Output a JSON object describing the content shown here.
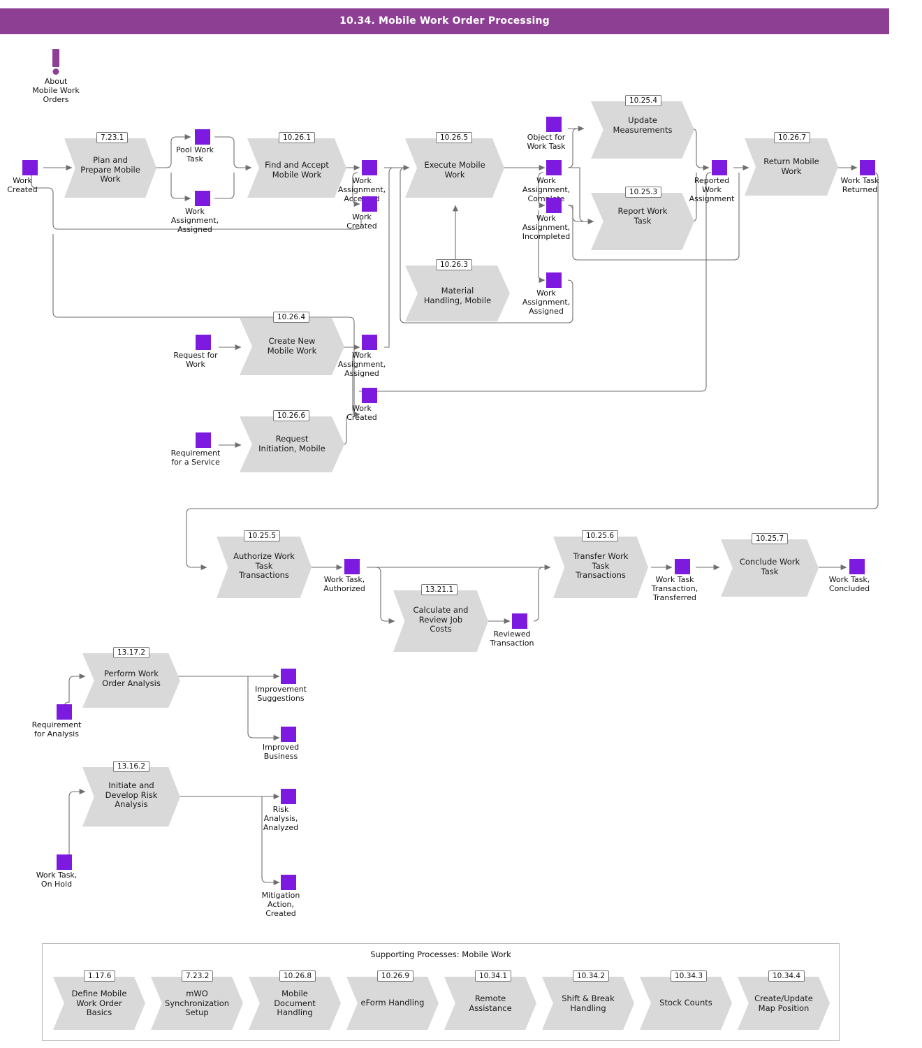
{
  "header": {
    "title": "10.34. Mobile Work Order Processing",
    "bar_color": "#8d3f94"
  },
  "colors": {
    "state": "#7d1ae0",
    "process": "#d9d9d9",
    "note": "#8d3f94",
    "line": "#6e6e6e"
  },
  "note": {
    "icon": "exclamation-icon",
    "label": "About\nMobile Work\nOrders",
    "lines": [
      "About",
      "Mobile Work",
      "Orders"
    ]
  },
  "processes": [
    {
      "id": "plan_prepare",
      "num": "7.23.1",
      "lines": [
        "Plan and",
        "Prepare Mobile",
        "Work"
      ]
    },
    {
      "id": "find_accept",
      "num": "10.26.1",
      "lines": [
        "Find and Accept",
        "Mobile Work"
      ]
    },
    {
      "id": "execute_mobile",
      "num": "10.26.5",
      "lines": [
        "Execute Mobile",
        "Work"
      ]
    },
    {
      "id": "material_handling",
      "num": "10.26.3",
      "lines": [
        "Material",
        "Handling, Mobile"
      ]
    },
    {
      "id": "update_meas",
      "num": "10.25.4",
      "lines": [
        "Update",
        "Measurements"
      ]
    },
    {
      "id": "report_work_task",
      "num": "10.25.3",
      "lines": [
        "Report Work",
        "Task"
      ]
    },
    {
      "id": "return_mobile",
      "num": "10.26.7",
      "lines": [
        "Return Mobile",
        "Work"
      ]
    },
    {
      "id": "create_new_mobile",
      "num": "10.26.4",
      "lines": [
        "Create New",
        "Mobile Work"
      ]
    },
    {
      "id": "request_init",
      "num": "10.26.6",
      "lines": [
        "Request",
        "Initiation, Mobile"
      ]
    },
    {
      "id": "authorize_wtt",
      "num": "10.25.5",
      "lines": [
        "Authorize Work",
        "Task",
        "Transactions"
      ]
    },
    {
      "id": "calc_job_costs",
      "num": "13.21.1",
      "lines": [
        "Calculate and",
        "Review Job",
        "Costs"
      ]
    },
    {
      "id": "transfer_wtt",
      "num": "10.25.6",
      "lines": [
        "Transfer Work",
        "Task",
        "Transactions"
      ]
    },
    {
      "id": "conclude_task",
      "num": "10.25.7",
      "lines": [
        "Conclude Work",
        "Task"
      ]
    },
    {
      "id": "perform_wo_analysis",
      "num": "13.17.2",
      "lines": [
        "Perform Work",
        "Order Analysis"
      ]
    },
    {
      "id": "initiate_risk",
      "num": "13.16.2",
      "lines": [
        "Initiate and",
        "Develop Risk",
        "Analysis"
      ]
    }
  ],
  "states": [
    {
      "id": "work_created_start",
      "lines": [
        "Work",
        "Created"
      ]
    },
    {
      "id": "pool_work_task",
      "lines": [
        "Pool Work",
        "Task"
      ]
    },
    {
      "id": "wa_assigned_1",
      "lines": [
        "Work",
        "Assignment,",
        "Assigned"
      ]
    },
    {
      "id": "wa_accepted",
      "lines": [
        "Work",
        "Assignment,",
        "Accepted"
      ]
    },
    {
      "id": "work_created_2",
      "lines": [
        "Work",
        "Created"
      ]
    },
    {
      "id": "object_for_work_task",
      "lines": [
        "Object for",
        "Work Task"
      ]
    },
    {
      "id": "wa_complete",
      "lines": [
        "Work",
        "Assignment,",
        "Complete"
      ]
    },
    {
      "id": "wa_incompleted",
      "lines": [
        "Work",
        "Assignment,",
        "Incompleted"
      ]
    },
    {
      "id": "wa_assigned_2",
      "lines": [
        "Work",
        "Assignment,",
        "Assigned"
      ]
    },
    {
      "id": "reported_wa",
      "lines": [
        "Reported",
        "Work",
        "Assignment"
      ]
    },
    {
      "id": "work_task_returned",
      "lines": [
        "Work Task",
        "Returned"
      ]
    },
    {
      "id": "request_for_work",
      "lines": [
        "Request for",
        "Work"
      ]
    },
    {
      "id": "wa_assigned_3",
      "lines": [
        "Work",
        "Assignment,",
        "Assigned"
      ]
    },
    {
      "id": "work_created_3",
      "lines": [
        "Work",
        "Created"
      ]
    },
    {
      "id": "requirement_service",
      "lines": [
        "Requirement",
        "for a Service"
      ]
    },
    {
      "id": "work_task_authorized",
      "lines": [
        "Work Task,",
        "Authorized"
      ]
    },
    {
      "id": "reviewed_transaction",
      "lines": [
        "Reviewed",
        "Transaction"
      ]
    },
    {
      "id": "wtt_transferred",
      "lines": [
        "Work Task",
        "Transaction,",
        "Transferred"
      ]
    },
    {
      "id": "work_task_concluded",
      "lines": [
        "Work Task,",
        "Concluded"
      ]
    },
    {
      "id": "requirement_analysis",
      "lines": [
        "Requirement",
        "for Analysis"
      ]
    },
    {
      "id": "improvement_suggestions",
      "lines": [
        "Improvement",
        "Suggestions"
      ]
    },
    {
      "id": "improved_business",
      "lines": [
        "Improved",
        "Business"
      ]
    },
    {
      "id": "work_task_on_hold",
      "lines": [
        "Work Task,",
        "On Hold"
      ]
    },
    {
      "id": "risk_analysis_analyzed",
      "lines": [
        "Risk",
        "Analysis,",
        "Analyzed"
      ]
    },
    {
      "id": "mitigation_action",
      "lines": [
        "Mitigation",
        "Action,",
        "Created"
      ]
    }
  ],
  "supporting": {
    "title": "Supporting Processes: Mobile Work",
    "items": [
      {
        "num": "1.17.6",
        "lines": [
          "Define Mobile",
          "Work Order",
          "Basics"
        ]
      },
      {
        "num": "7.23.2",
        "lines": [
          "mWO",
          "Synchronization",
          "Setup"
        ]
      },
      {
        "num": "10.26.8",
        "lines": [
          "Mobile",
          "Document",
          "Handling"
        ]
      },
      {
        "num": "10.26.9",
        "lines": [
          "eForm Handling"
        ]
      },
      {
        "num": "10.34.1",
        "lines": [
          "Remote",
          "Assistance"
        ]
      },
      {
        "num": "10.34.2",
        "lines": [
          "Shift & Break",
          "Handling"
        ]
      },
      {
        "num": "10.34.3",
        "lines": [
          "Stock Counts"
        ]
      },
      {
        "num": "10.34.4",
        "lines": [
          "Create/Update",
          "Map Position"
        ]
      }
    ]
  }
}
